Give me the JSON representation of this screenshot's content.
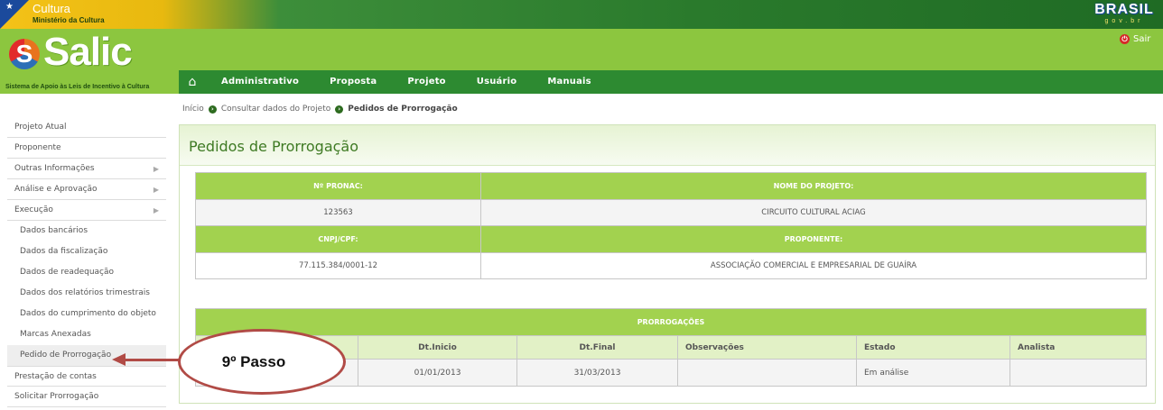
{
  "gov_bar": {
    "ministry_title": "Cultura",
    "ministry_subtitle": "Ministério da Cultura",
    "brasil_logo": "BRASIL",
    "brasil_url": "gov.br"
  },
  "header": {
    "logo_text": "Salic",
    "logo_s": "S",
    "tagline": "Sistema de Apoio às Leis de Incentivo à Cultura",
    "logout_label": "Sair",
    "accent_color": "#8cc63f",
    "nav_color": "#2d8a31"
  },
  "nav": {
    "home_icon": "home-icon",
    "items": [
      "Administrativo",
      "Proposta",
      "Projeto",
      "Usuário",
      "Manuais"
    ]
  },
  "breadcrumb": {
    "items": [
      "Início",
      "Consultar dados do Projeto",
      "Pedidos de Prorrogação"
    ]
  },
  "sidebar": {
    "items": [
      "Projeto Atual",
      "Proponente",
      "Outras Informações",
      "Análise e Aprovação",
      "Execução"
    ],
    "sub_items": [
      "Dados bancários",
      "Dados da fiscalização",
      "Dados de readequação",
      "Dados dos relatórios trimestrais",
      "Dados do cumprimento do objeto",
      "Marcas Anexadas",
      "Pedido de Prorrogação"
    ],
    "bottom_items": [
      "Prestação de contas",
      "Solicitar Prorrogação"
    ]
  },
  "main": {
    "title": "Pedidos de Prorrogação",
    "project_table": {
      "pronac_header": "Nº PRONAC:",
      "pronac_value": "123563",
      "name_header": "NOME DO PROJETO:",
      "name_value": "CIRCUITO CULTURAL ACIAG",
      "cnpj_header": "CNPJ/CPF:",
      "cnpj_value": "77.115.384/0001-12",
      "proponent_header": "PROPONENTE:",
      "proponent_value": "ASSOCIAÇÃO COMERCIAL E EMPRESARIAL DE GUAÍRA"
    },
    "extensions_table": {
      "caption": "PRORROGAÇÕES",
      "columns": [
        "Dt.Inicio",
        "Dt.Final",
        "Observações",
        "Estado",
        "Analista"
      ],
      "rows": [
        {
          "dt_inicio": "01/01/2013",
          "dt_final": "31/03/2013",
          "observacoes": "",
          "estado": "Em análise",
          "analista": ""
        }
      ]
    }
  },
  "annotation": {
    "step_label": "9º Passo",
    "color": "#b14b46"
  }
}
